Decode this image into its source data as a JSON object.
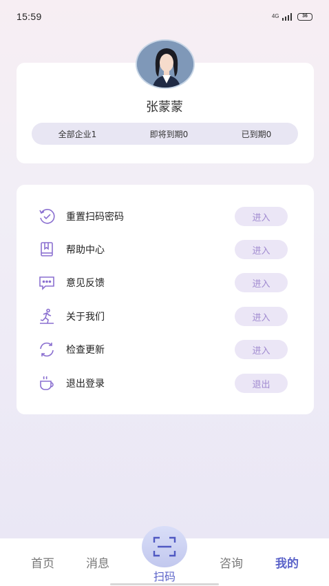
{
  "status_bar": {
    "time": "15:59",
    "network": "4G",
    "battery": "36"
  },
  "profile": {
    "name": "张蒙蒙",
    "avatar": "avatar-woman-icon",
    "stats": {
      "all_companies": "全部企业1",
      "expiring_soon": "即将到期0",
      "expired": "已到期0"
    }
  },
  "menu": {
    "items": [
      {
        "label": "重置扫码密码",
        "icon": "reset-check-icon",
        "button": "进入"
      },
      {
        "label": "帮助中心",
        "icon": "book-icon",
        "button": "进入"
      },
      {
        "label": "意见反馈",
        "icon": "chat-bubble-icon",
        "button": "进入"
      },
      {
        "label": "关于我们",
        "icon": "running-person-icon",
        "button": "进入"
      },
      {
        "label": "检查更新",
        "icon": "refresh-icon",
        "button": "进入"
      },
      {
        "label": "退出登录",
        "icon": "coffee-cup-icon",
        "button": "退出"
      }
    ]
  },
  "tab_bar": {
    "home": "首页",
    "messages": "消息",
    "scan": "扫码",
    "consult": "咨询",
    "mine": "我的"
  },
  "colors": {
    "accent": "#5b63c9",
    "icon_purple": "#8a6fd0",
    "button_bg": "#ebe6f6",
    "button_text": "#a08ad0"
  }
}
